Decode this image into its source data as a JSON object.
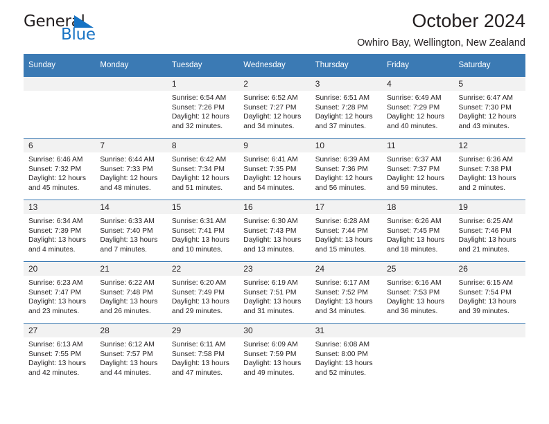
{
  "brand": {
    "name_top": "General",
    "name_bottom": "Blue",
    "accent_color": "#1773c4"
  },
  "header": {
    "title": "October 2024",
    "subtitle": "Owhiro Bay, Wellington, New Zealand"
  },
  "theme": {
    "header_blue": "#3b7ab4",
    "daynum_band": "#f2f2f2",
    "text": "#231f20"
  },
  "weekday_headers": [
    "Sunday",
    "Monday",
    "Tuesday",
    "Wednesday",
    "Thursday",
    "Friday",
    "Saturday"
  ],
  "weeks": [
    [
      {
        "day": "",
        "lines": []
      },
      {
        "day": "",
        "lines": []
      },
      {
        "day": "1",
        "lines": [
          "Sunrise: 6:54 AM",
          "Sunset: 7:26 PM",
          "Daylight: 12 hours",
          "and 32 minutes."
        ]
      },
      {
        "day": "2",
        "lines": [
          "Sunrise: 6:52 AM",
          "Sunset: 7:27 PM",
          "Daylight: 12 hours",
          "and 34 minutes."
        ]
      },
      {
        "day": "3",
        "lines": [
          "Sunrise: 6:51 AM",
          "Sunset: 7:28 PM",
          "Daylight: 12 hours",
          "and 37 minutes."
        ]
      },
      {
        "day": "4",
        "lines": [
          "Sunrise: 6:49 AM",
          "Sunset: 7:29 PM",
          "Daylight: 12 hours",
          "and 40 minutes."
        ]
      },
      {
        "day": "5",
        "lines": [
          "Sunrise: 6:47 AM",
          "Sunset: 7:30 PM",
          "Daylight: 12 hours",
          "and 43 minutes."
        ]
      }
    ],
    [
      {
        "day": "6",
        "lines": [
          "Sunrise: 6:46 AM",
          "Sunset: 7:32 PM",
          "Daylight: 12 hours",
          "and 45 minutes."
        ]
      },
      {
        "day": "7",
        "lines": [
          "Sunrise: 6:44 AM",
          "Sunset: 7:33 PM",
          "Daylight: 12 hours",
          "and 48 minutes."
        ]
      },
      {
        "day": "8",
        "lines": [
          "Sunrise: 6:42 AM",
          "Sunset: 7:34 PM",
          "Daylight: 12 hours",
          "and 51 minutes."
        ]
      },
      {
        "day": "9",
        "lines": [
          "Sunrise: 6:41 AM",
          "Sunset: 7:35 PM",
          "Daylight: 12 hours",
          "and 54 minutes."
        ]
      },
      {
        "day": "10",
        "lines": [
          "Sunrise: 6:39 AM",
          "Sunset: 7:36 PM",
          "Daylight: 12 hours",
          "and 56 minutes."
        ]
      },
      {
        "day": "11",
        "lines": [
          "Sunrise: 6:37 AM",
          "Sunset: 7:37 PM",
          "Daylight: 12 hours",
          "and 59 minutes."
        ]
      },
      {
        "day": "12",
        "lines": [
          "Sunrise: 6:36 AM",
          "Sunset: 7:38 PM",
          "Daylight: 13 hours",
          "and 2 minutes."
        ]
      }
    ],
    [
      {
        "day": "13",
        "lines": [
          "Sunrise: 6:34 AM",
          "Sunset: 7:39 PM",
          "Daylight: 13 hours",
          "and 4 minutes."
        ]
      },
      {
        "day": "14",
        "lines": [
          "Sunrise: 6:33 AM",
          "Sunset: 7:40 PM",
          "Daylight: 13 hours",
          "and 7 minutes."
        ]
      },
      {
        "day": "15",
        "lines": [
          "Sunrise: 6:31 AM",
          "Sunset: 7:41 PM",
          "Daylight: 13 hours",
          "and 10 minutes."
        ]
      },
      {
        "day": "16",
        "lines": [
          "Sunrise: 6:30 AM",
          "Sunset: 7:43 PM",
          "Daylight: 13 hours",
          "and 13 minutes."
        ]
      },
      {
        "day": "17",
        "lines": [
          "Sunrise: 6:28 AM",
          "Sunset: 7:44 PM",
          "Daylight: 13 hours",
          "and 15 minutes."
        ]
      },
      {
        "day": "18",
        "lines": [
          "Sunrise: 6:26 AM",
          "Sunset: 7:45 PM",
          "Daylight: 13 hours",
          "and 18 minutes."
        ]
      },
      {
        "day": "19",
        "lines": [
          "Sunrise: 6:25 AM",
          "Sunset: 7:46 PM",
          "Daylight: 13 hours",
          "and 21 minutes."
        ]
      }
    ],
    [
      {
        "day": "20",
        "lines": [
          "Sunrise: 6:23 AM",
          "Sunset: 7:47 PM",
          "Daylight: 13 hours",
          "and 23 minutes."
        ]
      },
      {
        "day": "21",
        "lines": [
          "Sunrise: 6:22 AM",
          "Sunset: 7:48 PM",
          "Daylight: 13 hours",
          "and 26 minutes."
        ]
      },
      {
        "day": "22",
        "lines": [
          "Sunrise: 6:20 AM",
          "Sunset: 7:49 PM",
          "Daylight: 13 hours",
          "and 29 minutes."
        ]
      },
      {
        "day": "23",
        "lines": [
          "Sunrise: 6:19 AM",
          "Sunset: 7:51 PM",
          "Daylight: 13 hours",
          "and 31 minutes."
        ]
      },
      {
        "day": "24",
        "lines": [
          "Sunrise: 6:17 AM",
          "Sunset: 7:52 PM",
          "Daylight: 13 hours",
          "and 34 minutes."
        ]
      },
      {
        "day": "25",
        "lines": [
          "Sunrise: 6:16 AM",
          "Sunset: 7:53 PM",
          "Daylight: 13 hours",
          "and 36 minutes."
        ]
      },
      {
        "day": "26",
        "lines": [
          "Sunrise: 6:15 AM",
          "Sunset: 7:54 PM",
          "Daylight: 13 hours",
          "and 39 minutes."
        ]
      }
    ],
    [
      {
        "day": "27",
        "lines": [
          "Sunrise: 6:13 AM",
          "Sunset: 7:55 PM",
          "Daylight: 13 hours",
          "and 42 minutes."
        ]
      },
      {
        "day": "28",
        "lines": [
          "Sunrise: 6:12 AM",
          "Sunset: 7:57 PM",
          "Daylight: 13 hours",
          "and 44 minutes."
        ]
      },
      {
        "day": "29",
        "lines": [
          "Sunrise: 6:11 AM",
          "Sunset: 7:58 PM",
          "Daylight: 13 hours",
          "and 47 minutes."
        ]
      },
      {
        "day": "30",
        "lines": [
          "Sunrise: 6:09 AM",
          "Sunset: 7:59 PM",
          "Daylight: 13 hours",
          "and 49 minutes."
        ]
      },
      {
        "day": "31",
        "lines": [
          "Sunrise: 6:08 AM",
          "Sunset: 8:00 PM",
          "Daylight: 13 hours",
          "and 52 minutes."
        ]
      },
      {
        "day": "",
        "lines": []
      },
      {
        "day": "",
        "lines": []
      }
    ]
  ]
}
